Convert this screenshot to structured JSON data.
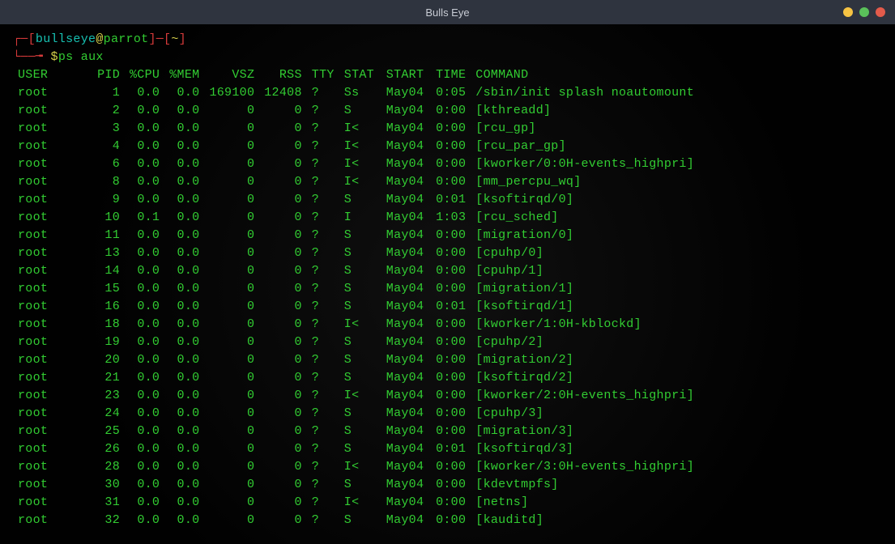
{
  "window": {
    "title": "Bulls Eye"
  },
  "prompt": {
    "user": "bullseye",
    "at": "@",
    "host": "parrot",
    "cwd": "~",
    "symbol": "$",
    "command": "ps aux"
  },
  "columns": [
    "USER",
    "PID",
    "%CPU",
    "%MEM",
    "VSZ",
    "RSS",
    "TTY",
    "STAT",
    "START",
    "TIME",
    "COMMAND"
  ],
  "rows": [
    {
      "user": "root",
      "pid": "1",
      "cpu": "0.0",
      "mem": "0.0",
      "vsz": "169100",
      "rss": "12408",
      "tty": "?",
      "stat": "Ss",
      "start": "May04",
      "time": "0:05",
      "cmd": "/sbin/init splash noautomount"
    },
    {
      "user": "root",
      "pid": "2",
      "cpu": "0.0",
      "mem": "0.0",
      "vsz": "0",
      "rss": "0",
      "tty": "?",
      "stat": "S",
      "start": "May04",
      "time": "0:00",
      "cmd": "[kthreadd]"
    },
    {
      "user": "root",
      "pid": "3",
      "cpu": "0.0",
      "mem": "0.0",
      "vsz": "0",
      "rss": "0",
      "tty": "?",
      "stat": "I<",
      "start": "May04",
      "time": "0:00",
      "cmd": "[rcu_gp]"
    },
    {
      "user": "root",
      "pid": "4",
      "cpu": "0.0",
      "mem": "0.0",
      "vsz": "0",
      "rss": "0",
      "tty": "?",
      "stat": "I<",
      "start": "May04",
      "time": "0:00",
      "cmd": "[rcu_par_gp]"
    },
    {
      "user": "root",
      "pid": "6",
      "cpu": "0.0",
      "mem": "0.0",
      "vsz": "0",
      "rss": "0",
      "tty": "?",
      "stat": "I<",
      "start": "May04",
      "time": "0:00",
      "cmd": "[kworker/0:0H-events_highpri]"
    },
    {
      "user": "root",
      "pid": "8",
      "cpu": "0.0",
      "mem": "0.0",
      "vsz": "0",
      "rss": "0",
      "tty": "?",
      "stat": "I<",
      "start": "May04",
      "time": "0:00",
      "cmd": "[mm_percpu_wq]"
    },
    {
      "user": "root",
      "pid": "9",
      "cpu": "0.0",
      "mem": "0.0",
      "vsz": "0",
      "rss": "0",
      "tty": "?",
      "stat": "S",
      "start": "May04",
      "time": "0:01",
      "cmd": "[ksoftirqd/0]"
    },
    {
      "user": "root",
      "pid": "10",
      "cpu": "0.1",
      "mem": "0.0",
      "vsz": "0",
      "rss": "0",
      "tty": "?",
      "stat": "I",
      "start": "May04",
      "time": "1:03",
      "cmd": "[rcu_sched]"
    },
    {
      "user": "root",
      "pid": "11",
      "cpu": "0.0",
      "mem": "0.0",
      "vsz": "0",
      "rss": "0",
      "tty": "?",
      "stat": "S",
      "start": "May04",
      "time": "0:00",
      "cmd": "[migration/0]"
    },
    {
      "user": "root",
      "pid": "13",
      "cpu": "0.0",
      "mem": "0.0",
      "vsz": "0",
      "rss": "0",
      "tty": "?",
      "stat": "S",
      "start": "May04",
      "time": "0:00",
      "cmd": "[cpuhp/0]"
    },
    {
      "user": "root",
      "pid": "14",
      "cpu": "0.0",
      "mem": "0.0",
      "vsz": "0",
      "rss": "0",
      "tty": "?",
      "stat": "S",
      "start": "May04",
      "time": "0:00",
      "cmd": "[cpuhp/1]"
    },
    {
      "user": "root",
      "pid": "15",
      "cpu": "0.0",
      "mem": "0.0",
      "vsz": "0",
      "rss": "0",
      "tty": "?",
      "stat": "S",
      "start": "May04",
      "time": "0:00",
      "cmd": "[migration/1]"
    },
    {
      "user": "root",
      "pid": "16",
      "cpu": "0.0",
      "mem": "0.0",
      "vsz": "0",
      "rss": "0",
      "tty": "?",
      "stat": "S",
      "start": "May04",
      "time": "0:01",
      "cmd": "[ksoftirqd/1]"
    },
    {
      "user": "root",
      "pid": "18",
      "cpu": "0.0",
      "mem": "0.0",
      "vsz": "0",
      "rss": "0",
      "tty": "?",
      "stat": "I<",
      "start": "May04",
      "time": "0:00",
      "cmd": "[kworker/1:0H-kblockd]"
    },
    {
      "user": "root",
      "pid": "19",
      "cpu": "0.0",
      "mem": "0.0",
      "vsz": "0",
      "rss": "0",
      "tty": "?",
      "stat": "S",
      "start": "May04",
      "time": "0:00",
      "cmd": "[cpuhp/2]"
    },
    {
      "user": "root",
      "pid": "20",
      "cpu": "0.0",
      "mem": "0.0",
      "vsz": "0",
      "rss": "0",
      "tty": "?",
      "stat": "S",
      "start": "May04",
      "time": "0:00",
      "cmd": "[migration/2]"
    },
    {
      "user": "root",
      "pid": "21",
      "cpu": "0.0",
      "mem": "0.0",
      "vsz": "0",
      "rss": "0",
      "tty": "?",
      "stat": "S",
      "start": "May04",
      "time": "0:00",
      "cmd": "[ksoftirqd/2]"
    },
    {
      "user": "root",
      "pid": "23",
      "cpu": "0.0",
      "mem": "0.0",
      "vsz": "0",
      "rss": "0",
      "tty": "?",
      "stat": "I<",
      "start": "May04",
      "time": "0:00",
      "cmd": "[kworker/2:0H-events_highpri]"
    },
    {
      "user": "root",
      "pid": "24",
      "cpu": "0.0",
      "mem": "0.0",
      "vsz": "0",
      "rss": "0",
      "tty": "?",
      "stat": "S",
      "start": "May04",
      "time": "0:00",
      "cmd": "[cpuhp/3]"
    },
    {
      "user": "root",
      "pid": "25",
      "cpu": "0.0",
      "mem": "0.0",
      "vsz": "0",
      "rss": "0",
      "tty": "?",
      "stat": "S",
      "start": "May04",
      "time": "0:00",
      "cmd": "[migration/3]"
    },
    {
      "user": "root",
      "pid": "26",
      "cpu": "0.0",
      "mem": "0.0",
      "vsz": "0",
      "rss": "0",
      "tty": "?",
      "stat": "S",
      "start": "May04",
      "time": "0:01",
      "cmd": "[ksoftirqd/3]"
    },
    {
      "user": "root",
      "pid": "28",
      "cpu": "0.0",
      "mem": "0.0",
      "vsz": "0",
      "rss": "0",
      "tty": "?",
      "stat": "I<",
      "start": "May04",
      "time": "0:00",
      "cmd": "[kworker/3:0H-events_highpri]"
    },
    {
      "user": "root",
      "pid": "30",
      "cpu": "0.0",
      "mem": "0.0",
      "vsz": "0",
      "rss": "0",
      "tty": "?",
      "stat": "S",
      "start": "May04",
      "time": "0:00",
      "cmd": "[kdevtmpfs]"
    },
    {
      "user": "root",
      "pid": "31",
      "cpu": "0.0",
      "mem": "0.0",
      "vsz": "0",
      "rss": "0",
      "tty": "?",
      "stat": "I<",
      "start": "May04",
      "time": "0:00",
      "cmd": "[netns]"
    },
    {
      "user": "root",
      "pid": "32",
      "cpu": "0.0",
      "mem": "0.0",
      "vsz": "0",
      "rss": "0",
      "tty": "?",
      "stat": "S",
      "start": "May04",
      "time": "0:00",
      "cmd": "[kauditd]"
    }
  ]
}
